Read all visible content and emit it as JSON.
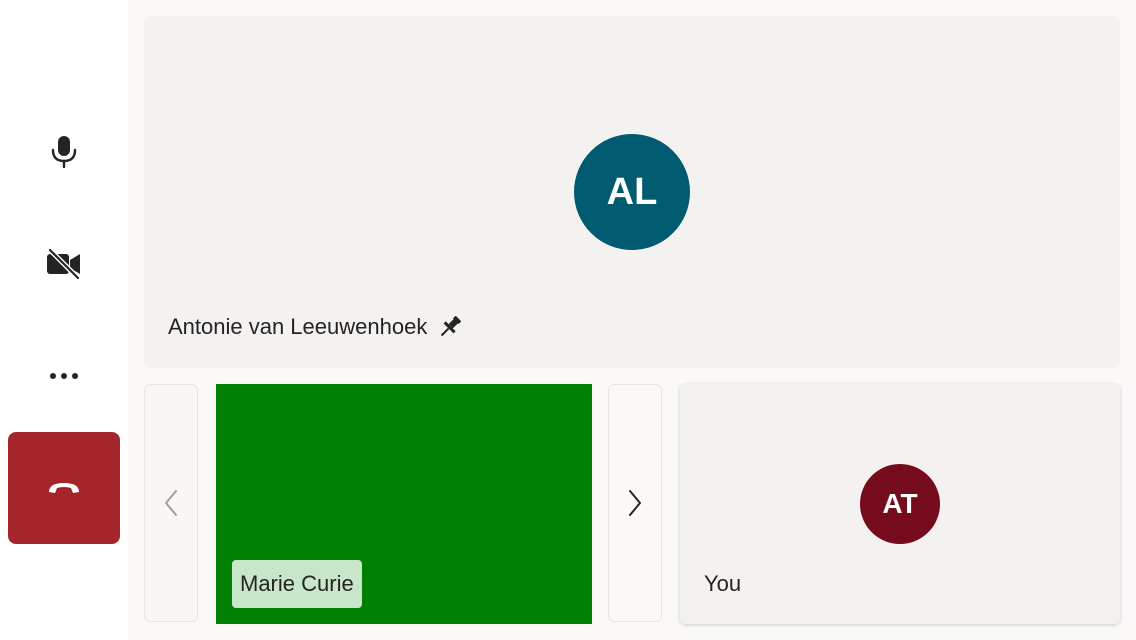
{
  "controls": {
    "mic_icon": "microphone-icon",
    "camera_icon": "video-off-icon",
    "more_icon": "more-options-icon",
    "hangup_icon": "hang-up-icon",
    "hangup_color": "#a4262c"
  },
  "main_tile": {
    "initials": "AL",
    "name": "Antonie van Leeuwenhoek",
    "pinned_icon": "pin-icon",
    "avatar_color": "#005b70"
  },
  "carousel": {
    "prev_icon": "chevron-left-icon",
    "next_icon": "chevron-right-icon",
    "tiles": [
      {
        "name": "Marie Curie",
        "video_color": "#008000"
      }
    ]
  },
  "self_tile": {
    "initials": "AT",
    "name": "You",
    "avatar_color": "#750b1c"
  }
}
